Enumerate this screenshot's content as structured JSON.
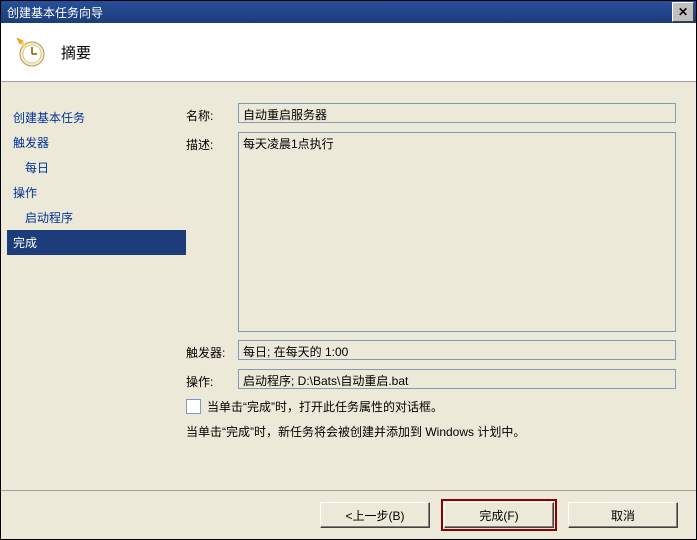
{
  "window": {
    "title": "创建基本任务向导"
  },
  "header": {
    "title": "摘要"
  },
  "sidebar": {
    "items": [
      {
        "label": "创建基本任务",
        "type": "item"
      },
      {
        "label": "触发器",
        "type": "item"
      },
      {
        "label": "每日",
        "type": "sub"
      },
      {
        "label": "操作",
        "type": "item"
      },
      {
        "label": "启动程序",
        "type": "sub"
      },
      {
        "label": "完成",
        "type": "item",
        "selected": true
      }
    ]
  },
  "form": {
    "name_label": "名称:",
    "name_value": "自动重启服务器",
    "desc_label": "描述:",
    "desc_value": "每天凌晨1点执行",
    "trigger_label": "触发器:",
    "trigger_value": "每日; 在每天的 1:00",
    "action_label": "操作:",
    "action_value": "启动程序; D:\\Bats\\自动重启.bat",
    "checkbox_label": "当单击“完成”时，打开此任务属性的对话框。",
    "info_text": "当单击“完成”时，新任务将会被创建并添加到 Windows 计划中。"
  },
  "buttons": {
    "back": "<上一步(B)",
    "finish": "完成(F)",
    "cancel": "取消"
  }
}
